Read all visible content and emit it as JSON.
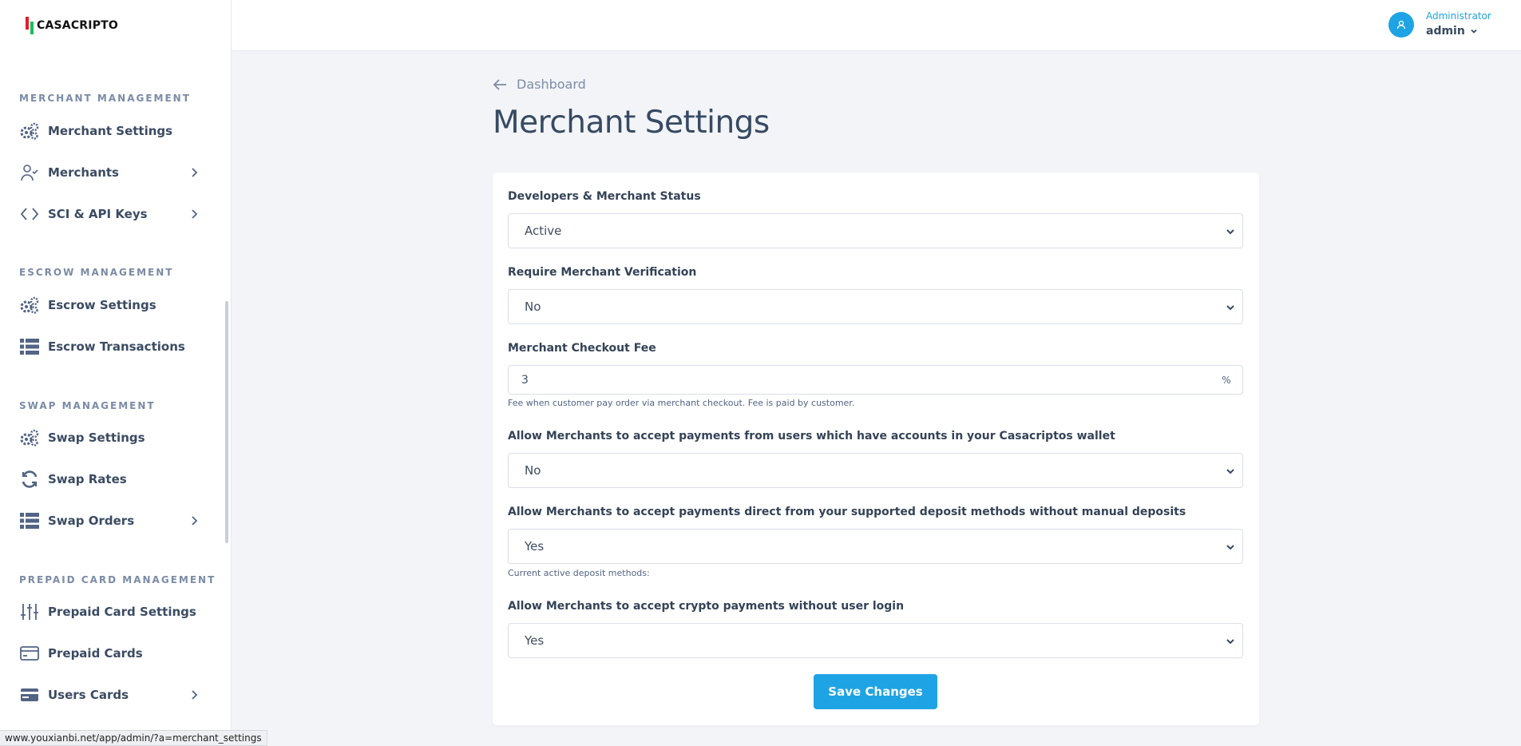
{
  "brand": {
    "name": "CASACRIPTO"
  },
  "header": {
    "user_role": "Administrator",
    "user_name": "admin"
  },
  "sidebar": {
    "sections": [
      {
        "title": "MERCHANT MANAGEMENT",
        "items": [
          {
            "label": "Merchant Settings",
            "icon": "gears-icon",
            "has_submenu": false
          },
          {
            "label": "Merchants",
            "icon": "user-check-icon",
            "has_submenu": true
          },
          {
            "label": "SCI & API Keys",
            "icon": "code-icon",
            "has_submenu": true
          }
        ]
      },
      {
        "title": "ESCROW MANAGEMENT",
        "items": [
          {
            "label": "Escrow Settings",
            "icon": "gears-icon",
            "has_submenu": false
          },
          {
            "label": "Escrow Transactions",
            "icon": "list-table-icon",
            "has_submenu": false
          }
        ]
      },
      {
        "title": "SWAP MANAGEMENT",
        "items": [
          {
            "label": "Swap Settings",
            "icon": "gears-icon",
            "has_submenu": false
          },
          {
            "label": "Swap Rates",
            "icon": "refresh-icon",
            "has_submenu": false
          },
          {
            "label": "Swap Orders",
            "icon": "list-table-icon",
            "has_submenu": true
          }
        ]
      },
      {
        "title": "PREPAID CARD MANAGEMENT",
        "items": [
          {
            "label": "Prepaid Card Settings",
            "icon": "sliders-icon",
            "has_submenu": false
          },
          {
            "label": "Prepaid Cards",
            "icon": "card-icon",
            "has_submenu": false
          },
          {
            "label": "Users Cards",
            "icon": "cards-icon",
            "has_submenu": true
          }
        ]
      }
    ]
  },
  "page": {
    "back_label": "Dashboard",
    "title": "Merchant Settings"
  },
  "form": {
    "status": {
      "label": "Developers & Merchant Status",
      "value": "Active"
    },
    "verification": {
      "label": "Require Merchant Verification",
      "value": "No"
    },
    "checkout_fee": {
      "label": "Merchant Checkout Fee",
      "value": "3",
      "suffix": "%",
      "help": "Fee when customer pay order via merchant checkout. Fee is paid by customer."
    },
    "wallet_payments": {
      "label": "Allow Merchants to accept payments from users which have accounts in your Casacriptos wallet",
      "value": "No"
    },
    "deposit_payments": {
      "label": "Allow Merchants to accept payments direct from your supported deposit methods without manual deposits",
      "value": "Yes",
      "help": "Current active deposit methods:"
    },
    "crypto_payments": {
      "label": "Allow Merchants to accept crypto payments without user login",
      "value": "Yes"
    },
    "save_label": "Save Changes"
  },
  "status_bar": {
    "url": "www.youxianbi.net/app/admin/?a=merchant_settings"
  },
  "colors": {
    "accent": "#1ea4e4",
    "text": "#364a63",
    "muted": "#7b8ba6"
  }
}
